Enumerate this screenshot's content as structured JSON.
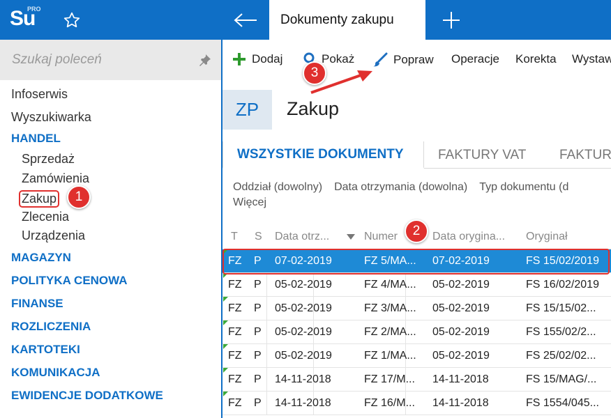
{
  "app": {
    "logo": "Su",
    "logo_sup": "PRO"
  },
  "tabs": {
    "active": "Dokumenty zakupu"
  },
  "sidebar": {
    "search_placeholder": "Szukaj poleceń",
    "items": [
      {
        "label": "Infoserwis",
        "type": "item"
      },
      {
        "label": "Wyszukiwarka",
        "type": "item"
      },
      {
        "label": "HANDEL",
        "type": "section"
      },
      {
        "label": "Sprzedaż",
        "type": "sub"
      },
      {
        "label": "Zamówienia",
        "type": "sub"
      },
      {
        "label": "Zakup",
        "type": "sub"
      },
      {
        "label": "Zlecenia",
        "type": "sub"
      },
      {
        "label": "Urządzenia",
        "type": "sub"
      },
      {
        "label": "MAGAZYN",
        "type": "section"
      },
      {
        "label": "POLITYKA CENOWA",
        "type": "section"
      },
      {
        "label": "FINANSE",
        "type": "section"
      },
      {
        "label": "ROZLICZENIA",
        "type": "section"
      },
      {
        "label": "KARTOTEKI",
        "type": "section"
      },
      {
        "label": "KOMUNIKACJA",
        "type": "section"
      },
      {
        "label": "EWIDENCJE DODATKOWE",
        "type": "section"
      }
    ]
  },
  "toolbar": {
    "add": "Dodaj",
    "show": "Pokaż",
    "edit": "Popraw",
    "operations": "Operacje",
    "correction": "Korekta",
    "issue": "Wystaw"
  },
  "header": {
    "code": "ZP",
    "title": "Zakup"
  },
  "doc_tabs": [
    "WSZYSTKIE DOKUMENTY",
    "FAKTURY VAT",
    "FAKTURY"
  ],
  "filters": [
    "Oddział (dowolny)",
    "Data otrzymania (dowolna)",
    "Typ dokumentu (d",
    "Więcej"
  ],
  "table": {
    "columns": [
      "T",
      "S",
      "Data otrz...",
      "Numer",
      "Data orygina...",
      "Oryginał"
    ],
    "rows": [
      [
        "FZ",
        "P",
        "07-02-2019",
        "FZ 5/MA...",
        "07-02-2019",
        "FS 15/02/2019"
      ],
      [
        "FZ",
        "P",
        "05-02-2019",
        "FZ 4/MA...",
        "05-02-2019",
        "FS 16/02/2019"
      ],
      [
        "FZ",
        "P",
        "05-02-2019",
        "FZ 3/MA...",
        "05-02-2019",
        "FS 15/15/02..."
      ],
      [
        "FZ",
        "P",
        "05-02-2019",
        "FZ 2/MA...",
        "05-02-2019",
        "FS 155/02/2..."
      ],
      [
        "FZ",
        "P",
        "05-02-2019",
        "FZ 1/MA...",
        "05-02-2019",
        "FS 25/02/02..."
      ],
      [
        "FZ",
        "P",
        "14-11-2018",
        "FZ 17/M...",
        "14-11-2018",
        "FS 15/MAG/..."
      ],
      [
        "FZ",
        "P",
        "14-11-2018",
        "FZ 16/M...",
        "14-11-2018",
        "FS 1554/045..."
      ]
    ]
  },
  "annotations": [
    "1",
    "2",
    "3"
  ],
  "colors": {
    "accent": "#0f6fc6",
    "selection": "#1e8ad6",
    "badge": "#e0302e"
  }
}
